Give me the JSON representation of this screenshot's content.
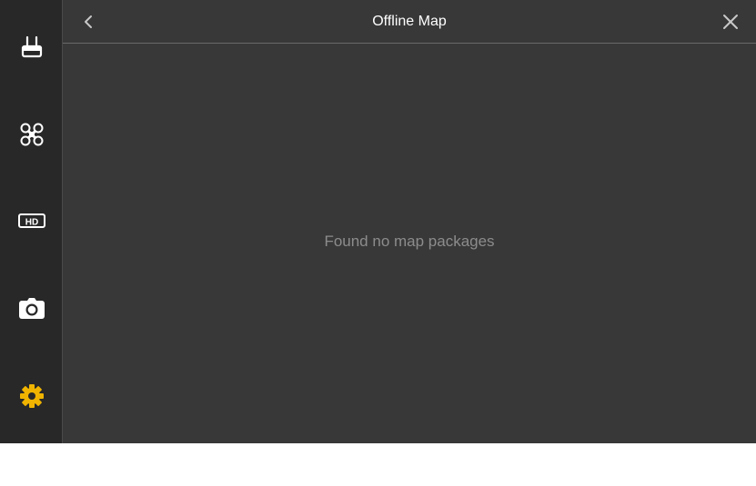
{
  "header": {
    "title": "Offline Map"
  },
  "sidebar": {
    "items": [
      {
        "icon": "remote-controller-icon",
        "active": false
      },
      {
        "icon": "aircraft-icon",
        "active": false
      },
      {
        "icon": "hd-transmission-icon",
        "active": false,
        "label": "HD"
      },
      {
        "icon": "camera-icon",
        "active": false
      },
      {
        "icon": "gear-icon",
        "active": true
      }
    ]
  },
  "content": {
    "empty_message": "Found no map packages"
  },
  "colors": {
    "background": "#383838",
    "sidebar": "#282828",
    "icon": "#ffffff",
    "accent": "#f0b400",
    "muted_text": "#8c8c8c"
  }
}
